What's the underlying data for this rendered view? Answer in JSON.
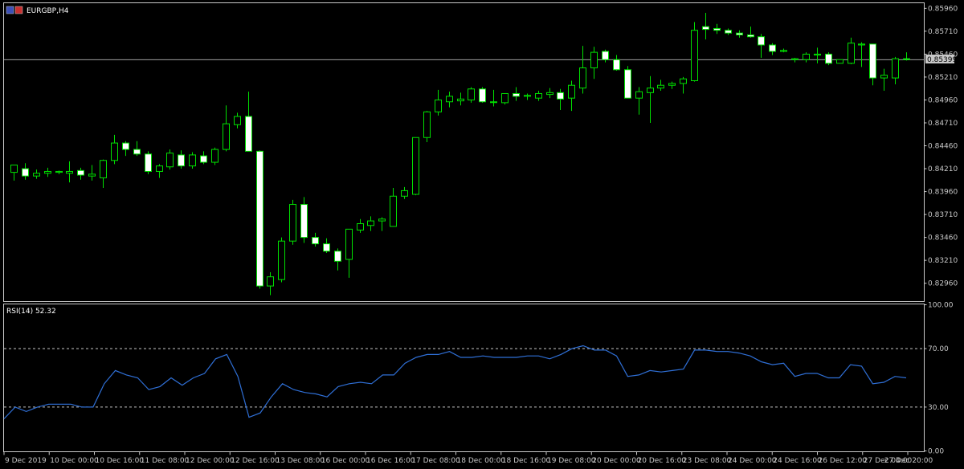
{
  "symbol_label": "EURGBP,H4",
  "rsi_label": "RSI(14) 52.32",
  "current_price_label": "0.85399",
  "colors": {
    "background": "#000000",
    "frame": "#c8c8c8",
    "bull_fill": "#000000",
    "bear_fill": "#ffffff",
    "candle_outline": "#00e000",
    "price_line": "#a0a0a0",
    "rsi_line": "#2f6fd6",
    "level_line": "#c8c8c8",
    "price_tag_bg": "#c8c8c8",
    "price_tag_text": "#000000"
  },
  "chart_data": {
    "type": "candlestick",
    "price_ticks": [
      "0.85960",
      "0.85710",
      "0.85460",
      "0.85210",
      "0.84960",
      "0.84710",
      "0.84460",
      "0.84210",
      "0.83960",
      "0.83710",
      "0.83460",
      "0.83210",
      "0.82960"
    ],
    "price_range": [
      0.8276,
      0.8602
    ],
    "current_price": 0.85399,
    "time_labels": [
      "9 Dec 2019",
      "10 Dec 00:00",
      "10 Dec 16:00",
      "11 Dec 08:00",
      "12 Dec 00:00",
      "12 Dec 16:00",
      "13 Dec 08:00",
      "16 Dec 00:00",
      "16 Dec 16:00",
      "17 Dec 08:00",
      "18 Dec 00:00",
      "18 Dec 16:00",
      "19 Dec 08:00",
      "20 Dec 00:00",
      "20 Dec 16:00",
      "23 Dec 08:00",
      "24 Dec 00:00",
      "24 Dec 16:00",
      "26 Dec 12:00",
      "27 Dec 04:00",
      "27 Dec 20:00"
    ],
    "candles": [
      {
        "o": 0.8417,
        "h": 0.8424,
        "l": 0.8408,
        "c": 0.8425
      },
      {
        "o": 0.8421,
        "h": 0.8427,
        "l": 0.8409,
        "c": 0.8413
      },
      {
        "o": 0.8413,
        "h": 0.842,
        "l": 0.841,
        "c": 0.8416
      },
      {
        "o": 0.8416,
        "h": 0.8422,
        "l": 0.8412,
        "c": 0.8418
      },
      {
        "o": 0.8417,
        "h": 0.8419,
        "l": 0.8415,
        "c": 0.8418
      },
      {
        "o": 0.8416,
        "h": 0.8429,
        "l": 0.8406,
        "c": 0.8418
      },
      {
        "o": 0.8419,
        "h": 0.8422,
        "l": 0.8409,
        "c": 0.8414
      },
      {
        "o": 0.8413,
        "h": 0.8425,
        "l": 0.8408,
        "c": 0.8415
      },
      {
        "o": 0.8411,
        "h": 0.8431,
        "l": 0.84,
        "c": 0.843
      },
      {
        "o": 0.843,
        "h": 0.8458,
        "l": 0.8426,
        "c": 0.8449
      },
      {
        "o": 0.8449,
        "h": 0.8451,
        "l": 0.8435,
        "c": 0.8442
      },
      {
        "o": 0.8442,
        "h": 0.8451,
        "l": 0.8435,
        "c": 0.8437
      },
      {
        "o": 0.8437,
        "h": 0.844,
        "l": 0.8415,
        "c": 0.8418
      },
      {
        "o": 0.8418,
        "h": 0.8426,
        "l": 0.8411,
        "c": 0.8424
      },
      {
        "o": 0.8423,
        "h": 0.8442,
        "l": 0.842,
        "c": 0.8438
      },
      {
        "o": 0.8436,
        "h": 0.8441,
        "l": 0.8421,
        "c": 0.8424
      },
      {
        "o": 0.8424,
        "h": 0.8439,
        "l": 0.8421,
        "c": 0.8436
      },
      {
        "o": 0.8435,
        "h": 0.844,
        "l": 0.8426,
        "c": 0.8428
      },
      {
        "o": 0.8428,
        "h": 0.8444,
        "l": 0.8425,
        "c": 0.8442
      },
      {
        "o": 0.8442,
        "h": 0.849,
        "l": 0.844,
        "c": 0.847
      },
      {
        "o": 0.8469,
        "h": 0.8482,
        "l": 0.8465,
        "c": 0.8478
      },
      {
        "o": 0.8478,
        "h": 0.8505,
        "l": 0.8441,
        "c": 0.844
      },
      {
        "o": 0.844,
        "h": 0.8441,
        "l": 0.829,
        "c": 0.8293
      },
      {
        "o": 0.8293,
        "h": 0.8308,
        "l": 0.8283,
        "c": 0.8303
      },
      {
        "o": 0.83,
        "h": 0.8346,
        "l": 0.8297,
        "c": 0.8342
      },
      {
        "o": 0.8342,
        "h": 0.8387,
        "l": 0.8338,
        "c": 0.8382
      },
      {
        "o": 0.8382,
        "h": 0.839,
        "l": 0.834,
        "c": 0.8346
      },
      {
        "o": 0.8346,
        "h": 0.8351,
        "l": 0.8336,
        "c": 0.8339
      },
      {
        "o": 0.8339,
        "h": 0.8345,
        "l": 0.8329,
        "c": 0.8331
      },
      {
        "o": 0.8331,
        "h": 0.8334,
        "l": 0.831,
        "c": 0.832
      },
      {
        "o": 0.8322,
        "h": 0.8354,
        "l": 0.8302,
        "c": 0.8355
      },
      {
        "o": 0.8354,
        "h": 0.8366,
        "l": 0.8351,
        "c": 0.8361
      },
      {
        "o": 0.8359,
        "h": 0.8369,
        "l": 0.8353,
        "c": 0.8364
      },
      {
        "o": 0.8364,
        "h": 0.8368,
        "l": 0.8353,
        "c": 0.8366
      },
      {
        "o": 0.8358,
        "h": 0.84,
        "l": 0.8358,
        "c": 0.8391
      },
      {
        "o": 0.8391,
        "h": 0.8401,
        "l": 0.8388,
        "c": 0.8397
      },
      {
        "o": 0.8393,
        "h": 0.8455,
        "l": 0.8392,
        "c": 0.8455
      },
      {
        "o": 0.8455,
        "h": 0.8484,
        "l": 0.845,
        "c": 0.8483
      },
      {
        "o": 0.8483,
        "h": 0.8507,
        "l": 0.8479,
        "c": 0.8496
      },
      {
        "o": 0.8494,
        "h": 0.8505,
        "l": 0.8488,
        "c": 0.85
      },
      {
        "o": 0.8495,
        "h": 0.8504,
        "l": 0.849,
        "c": 0.8497
      },
      {
        "o": 0.8496,
        "h": 0.851,
        "l": 0.8493,
        "c": 0.8508
      },
      {
        "o": 0.8508,
        "h": 0.851,
        "l": 0.8493,
        "c": 0.8494
      },
      {
        "o": 0.8494,
        "h": 0.8507,
        "l": 0.8489,
        "c": 0.8494
      },
      {
        "o": 0.8493,
        "h": 0.8502,
        "l": 0.8491,
        "c": 0.8503
      },
      {
        "o": 0.8503,
        "h": 0.851,
        "l": 0.8495,
        "c": 0.85
      },
      {
        "o": 0.85,
        "h": 0.8503,
        "l": 0.8496,
        "c": 0.8501
      },
      {
        "o": 0.8498,
        "h": 0.8506,
        "l": 0.8495,
        "c": 0.8503
      },
      {
        "o": 0.8502,
        "h": 0.8509,
        "l": 0.8498,
        "c": 0.8504
      },
      {
        "o": 0.8504,
        "h": 0.8508,
        "l": 0.8485,
        "c": 0.8497
      },
      {
        "o": 0.8498,
        "h": 0.8517,
        "l": 0.8484,
        "c": 0.8512
      },
      {
        "o": 0.8509,
        "h": 0.8555,
        "l": 0.8503,
        "c": 0.8531
      },
      {
        "o": 0.8531,
        "h": 0.8554,
        "l": 0.8519,
        "c": 0.8548
      },
      {
        "o": 0.8549,
        "h": 0.8551,
        "l": 0.8537,
        "c": 0.854
      },
      {
        "o": 0.854,
        "h": 0.8545,
        "l": 0.8528,
        "c": 0.8529
      },
      {
        "o": 0.8529,
        "h": 0.8533,
        "l": 0.85,
        "c": 0.8498
      },
      {
        "o": 0.8498,
        "h": 0.851,
        "l": 0.848,
        "c": 0.8505
      },
      {
        "o": 0.8504,
        "h": 0.8522,
        "l": 0.8471,
        "c": 0.8509
      },
      {
        "o": 0.8509,
        "h": 0.8518,
        "l": 0.8506,
        "c": 0.8512
      },
      {
        "o": 0.8512,
        "h": 0.8516,
        "l": 0.8508,
        "c": 0.8514
      },
      {
        "o": 0.8514,
        "h": 0.8521,
        "l": 0.8503,
        "c": 0.8519
      },
      {
        "o": 0.8517,
        "h": 0.8581,
        "l": 0.8516,
        "c": 0.8572
      },
      {
        "o": 0.8576,
        "h": 0.8591,
        "l": 0.8562,
        "c": 0.8573
      },
      {
        "o": 0.8574,
        "h": 0.8579,
        "l": 0.8568,
        "c": 0.8572
      },
      {
        "o": 0.8572,
        "h": 0.8574,
        "l": 0.8567,
        "c": 0.8569
      },
      {
        "o": 0.8569,
        "h": 0.8572,
        "l": 0.8564,
        "c": 0.8567
      },
      {
        "o": 0.8567,
        "h": 0.8576,
        "l": 0.8564,
        "c": 0.8565
      },
      {
        "o": 0.8565,
        "h": 0.8568,
        "l": 0.8542,
        "c": 0.8556
      },
      {
        "o": 0.8556,
        "h": 0.8558,
        "l": 0.8545,
        "c": 0.8549
      },
      {
        "o": 0.8549,
        "h": 0.8552,
        "l": 0.8548,
        "c": 0.855
      },
      {
        "o": 0.854,
        "h": 0.8542,
        "l": 0.8537,
        "c": 0.8541
      },
      {
        "o": 0.854,
        "h": 0.8548,
        "l": 0.8537,
        "c": 0.8546
      },
      {
        "o": 0.8545,
        "h": 0.8553,
        "l": 0.8536,
        "c": 0.8546
      },
      {
        "o": 0.8546,
        "h": 0.8548,
        "l": 0.8534,
        "c": 0.8536
      },
      {
        "o": 0.8536,
        "h": 0.854,
        "l": 0.8536,
        "c": 0.854
      },
      {
        "o": 0.8536,
        "h": 0.8564,
        "l": 0.8535,
        "c": 0.8558
      },
      {
        "o": 0.8556,
        "h": 0.8559,
        "l": 0.8532,
        "c": 0.8557
      },
      {
        "o": 0.8557,
        "h": 0.8557,
        "l": 0.8512,
        "c": 0.852
      },
      {
        "o": 0.852,
        "h": 0.853,
        "l": 0.8506,
        "c": 0.8523
      },
      {
        "o": 0.852,
        "h": 0.8543,
        "l": 0.8513,
        "c": 0.8541
      },
      {
        "o": 0.8541,
        "h": 0.8548,
        "l": 0.8539,
        "c": 0.854
      }
    ],
    "rsi": {
      "label": "RSI(14)",
      "range": [
        0,
        100
      ],
      "levels": [
        30,
        70
      ],
      "ticks": [
        "100.00",
        "70.00",
        "30.00",
        "0.00"
      ],
      "values": [
        22,
        30,
        27,
        30,
        32,
        32,
        32,
        30,
        30,
        46,
        55,
        52,
        50,
        42,
        44,
        50,
        45,
        50,
        53,
        63,
        66,
        51,
        23,
        26,
        37,
        46,
        42,
        40,
        39,
        37,
        44,
        46,
        47,
        46,
        52,
        52,
        60,
        64,
        66,
        66,
        68,
        64,
        64,
        65,
        64,
        64,
        64,
        65,
        65,
        63,
        66,
        70,
        72,
        69,
        69,
        65,
        51,
        52,
        55,
        54,
        55,
        56,
        69,
        69,
        68,
        68,
        67,
        65,
        61,
        59,
        60,
        51,
        53,
        53,
        50,
        50,
        59,
        58,
        46,
        47,
        51,
        50
      ]
    }
  }
}
